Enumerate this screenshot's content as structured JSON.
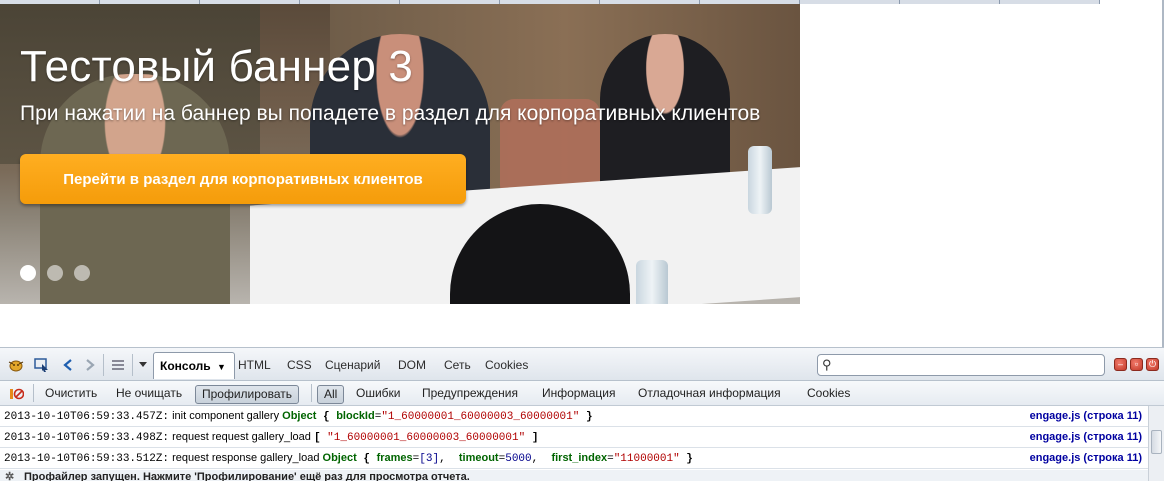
{
  "banner": {
    "title": "Тестовый баннер 3",
    "subtitle": "При нажатии на баннер вы попадете в раздел для корпоративных клиентов",
    "cta_label": "Перейти в раздел для корпоративных клиентов",
    "slides_count": 3,
    "active_slide": 1
  },
  "firebug": {
    "tabs": {
      "console": "Консоль",
      "html": "HTML",
      "css": "CSS",
      "script": "Сценарий",
      "dom": "DOM",
      "net": "Сеть",
      "cookies": "Cookies"
    },
    "search": {
      "placeholder": ""
    },
    "filters": {
      "clear": "Очистить",
      "persist": "Не очищать",
      "profile": "Профилировать",
      "all": "All",
      "errors": "Ошибки",
      "warnings": "Предупреждения",
      "info": "Информация",
      "debug": "Отладочная информация",
      "cookies": "Cookies"
    },
    "log": [
      {
        "timestamp": "2013-10-10T06:59:33.457Z:",
        "message": " init component gallery ",
        "object_label": "Object",
        "open": " { ",
        "key1": "blockId",
        "value1": "\"1_60000001_60000003_60000001\"",
        "close": " }",
        "source": "engage.js (строка 11)"
      },
      {
        "timestamp": "2013-10-10T06:59:33.498Z:",
        "message": " request request gallery_load ",
        "open": "[ ",
        "value1": "\"1_60000001_60000003_60000001\"",
        "close": " ]",
        "source": "engage.js (строка 11)"
      },
      {
        "timestamp": "2013-10-10T06:59:33.512Z:",
        "message": " request response gallery_load ",
        "object_label": "Object",
        "open": " { ",
        "key1": "frames",
        "value1": "[3]",
        "key2": "timeout",
        "value2": "5000",
        "key3": "first_index",
        "value3": "\"11000001\"",
        "close": " }",
        "source": "engage.js (строка 11)"
      }
    ],
    "status": "Профайлер запущен. Нажмите 'Профилирование' ещё раз для просмотра отчета."
  },
  "colors": {
    "cta": "#f7a21a",
    "log_key": "#006400",
    "log_string": "#b00000",
    "log_source": "#0000a0"
  }
}
